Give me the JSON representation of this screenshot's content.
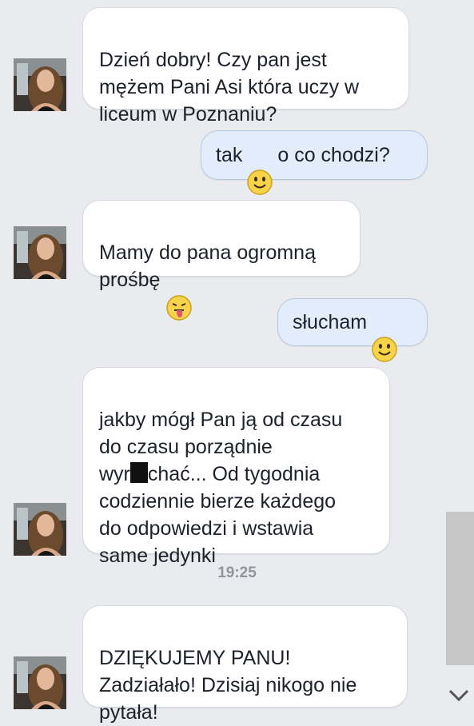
{
  "messages": [
    {
      "side": "incoming",
      "text": "Dzień dobry! Czy pan jest\nmężem Pani Asi która uczy w\nliceum w Poznaniu?"
    },
    {
      "side": "outgoing",
      "text_before": "tak",
      "emoji": "smile-emoji",
      "text_after": "o co chodzi?"
    },
    {
      "side": "incoming",
      "text": "Mamy do pana ogromną\nprośbę",
      "emoji": "tongue-emoji"
    },
    {
      "side": "outgoing",
      "text_before": "słucham",
      "emoji": "smile-emoji"
    },
    {
      "side": "incoming",
      "text_1": "jakby mógł Pan ją od czasu\ndo czasu porządnie\nwyr",
      "censored": true,
      "text_2": "chać... Od tygodnia\ncodziennie bierze każdego\ndo odpowiedzi i wstawia\nsame jedynki"
    },
    {
      "side": "incoming",
      "text": "DZIĘKUJEMY PANU!\nZadziałało! Dzisiaj nikogo nie\npytała!"
    }
  ],
  "timestamp": "19:25",
  "colors": {
    "background": "#e9ebee",
    "incoming_bubble": "#ffffff",
    "outgoing_bubble": "#e2ecfa",
    "outgoing_border": "#b8c7de",
    "timestamp": "#90949c"
  },
  "icons": {
    "scroll_down": "chevron-down-icon",
    "avatar": "avatar"
  }
}
